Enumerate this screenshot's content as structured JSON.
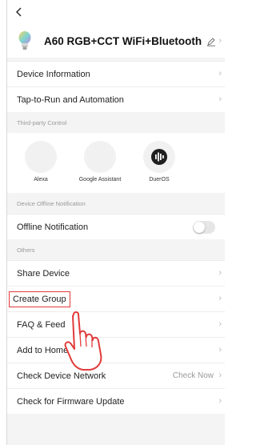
{
  "nav": {
    "back_icon": "chevron-left-icon"
  },
  "device": {
    "name": "A60 RGB+CCT WiFi+Bluetooth",
    "icon": "bulb-icon",
    "edit_icon": "pencil-icon"
  },
  "menu": {
    "device_information": "Device Information",
    "tap_to_run": "Tap-to-Run and Automation",
    "offline_notification": "Offline Notification",
    "share_device": "Share Device",
    "create_group": "Create Group",
    "faq": "FAQ & Feed",
    "add_home": "Add to Home Screen",
    "check_network": "Check Device Network",
    "check_network_action": "Check Now",
    "firmware": "Check for Firmware Update"
  },
  "sections": {
    "third_party": "Third-party Control",
    "offline": "Device Offline Notification",
    "others": "Others"
  },
  "third_party": [
    {
      "label": "Alexa"
    },
    {
      "label": "Google Assistant"
    },
    {
      "label": "DuerOS"
    }
  ],
  "offline_toggle_on": false,
  "colors": {
    "highlight": "#e23b3b"
  },
  "chevron": "›"
}
